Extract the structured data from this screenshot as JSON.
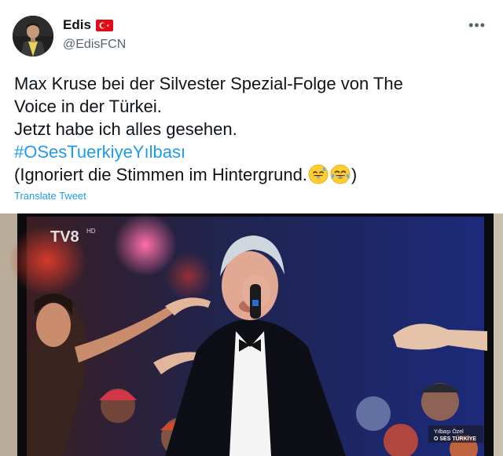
{
  "user": {
    "display_name": "Edis",
    "handle": "@EdisFCN",
    "flag_icon": "turkey-flag-icon"
  },
  "menu": {
    "more_label": "•••"
  },
  "tweet": {
    "lines": [
      "Max Kruse bei der Silvester Spezial-Folge von The",
      "Voice in der Türkei.",
      "Jetzt habe ich alles gesehen."
    ],
    "hashtag": "#OSesTuerkiyeYılbası",
    "last_line": "(Ignoriert die Stimmen im Hintergrund.",
    "last_line_end": ")",
    "emojis": [
      "sweat-smile-emoji",
      "tears-of-joy-emoji"
    ]
  },
  "translate_label": "Translate Tweet",
  "media": {
    "channel_logo": "TV8",
    "channel_suffix": "HD",
    "corner_caption_1": "Yılbaşı Özel",
    "corner_caption_2": "O SES TÜRKİYE"
  },
  "colors": {
    "accent": "#1d9bf0",
    "text": "#0f1419",
    "secondary": "#536471",
    "flag_red": "#e30a17"
  }
}
